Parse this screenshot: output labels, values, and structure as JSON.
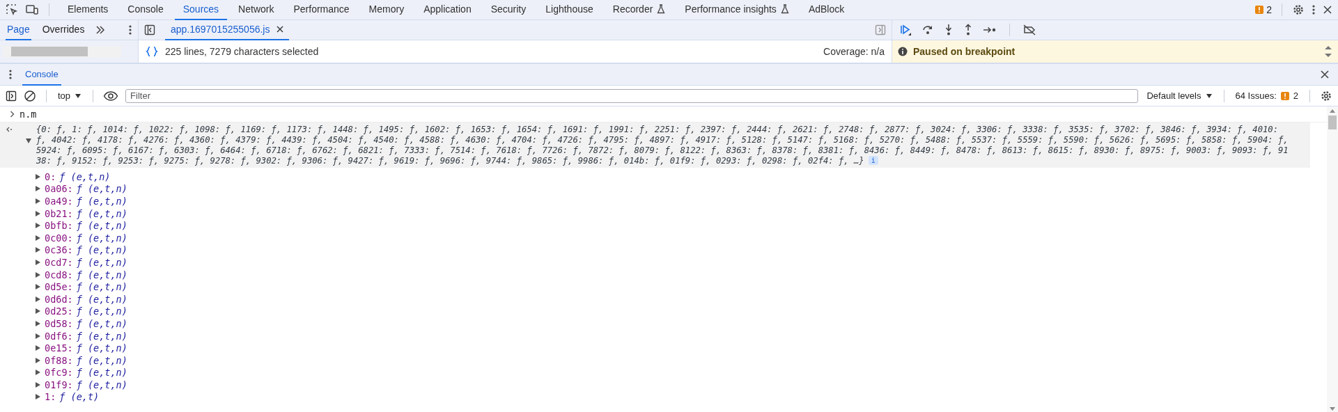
{
  "toolbar_tabs": [
    {
      "label": "Elements",
      "selected": false,
      "experimental": false
    },
    {
      "label": "Console",
      "selected": false,
      "experimental": false
    },
    {
      "label": "Sources",
      "selected": true,
      "experimental": false
    },
    {
      "label": "Network",
      "selected": false,
      "experimental": false
    },
    {
      "label": "Performance",
      "selected": false,
      "experimental": false
    },
    {
      "label": "Memory",
      "selected": false,
      "experimental": false
    },
    {
      "label": "Application",
      "selected": false,
      "experimental": false
    },
    {
      "label": "Security",
      "selected": false,
      "experimental": false
    },
    {
      "label": "Lighthouse",
      "selected": false,
      "experimental": false
    },
    {
      "label": "Recorder",
      "selected": false,
      "experimental": true
    },
    {
      "label": "Performance insights",
      "selected": false,
      "experimental": true
    },
    {
      "label": "AdBlock",
      "selected": false,
      "experimental": false
    }
  ],
  "issues_badge": "2",
  "navigator_tabs": [
    {
      "label": "Page",
      "selected": true
    },
    {
      "label": "Overrides",
      "selected": false
    }
  ],
  "editor_tabs": [
    {
      "label": "app.1697015255056.js",
      "selected": true
    }
  ],
  "status": {
    "selection": "225 lines, 7279 characters selected",
    "coverage": "Coverage: n/a"
  },
  "debugger": {
    "paused_message": "Paused on breakpoint"
  },
  "drawer_tabs": [
    {
      "label": "Console",
      "selected": true
    }
  ],
  "console_toolbar": {
    "context": "top",
    "filter_placeholder": "Filter",
    "levels": "Default levels",
    "issues_label": "64 Issues:",
    "issues_count": "2"
  },
  "console": {
    "input": "n.m",
    "result": {
      "expanded": true,
      "preview_lines": [
        "{0: ƒ, 1: ƒ, 1014: ƒ, 1022: ƒ, 1098: ƒ, 1169: ƒ, 1173: ƒ, 1448: ƒ, 1495: ƒ, 1602: ƒ, 1653: ƒ, 1654: ƒ, 1691: ƒ, 1991: ƒ, 2251: ƒ, 2397: ƒ, 2444: ƒ, 2621: ƒ, 2748: ƒ, 2877: ƒ, 3024: ƒ, 3306: ƒ, 3338: ƒ, 3535: ƒ, 3702: ƒ, 3846: ƒ, 3934: ƒ, 4010:",
        "ƒ, 4042: ƒ, 4178: ƒ, 4276: ƒ, 4360: ƒ, 4379: ƒ, 4439: ƒ, 4504: ƒ, 4540: ƒ, 4588: ƒ, 4630: ƒ, 4704: ƒ, 4726: ƒ, 4795: ƒ, 4897: ƒ, 4917: ƒ, 5128: ƒ, 5147: ƒ, 5168: ƒ, 5270: ƒ, 5488: ƒ, 5537: ƒ, 5559: ƒ, 5590: ƒ, 5626: ƒ, 5695: ƒ, 5858: ƒ, 5904: ƒ,",
        "5924: ƒ, 6095: ƒ, 6167: ƒ, 6303: ƒ, 6464: ƒ, 6718: ƒ, 6762: ƒ, 6821: ƒ, 7333: ƒ, 7514: ƒ, 7618: ƒ, 7726: ƒ, 7872: ƒ, 8079: ƒ, 8122: ƒ, 8363: ƒ, 8378: ƒ, 8381: ƒ, 8436: ƒ, 8449: ƒ, 8478: ƒ, 8613: ƒ, 8615: ƒ, 8930: ƒ, 8975: ƒ, 9003: ƒ, 9093: ƒ, 91",
        "38: ƒ, 9152: ƒ, 9253: ƒ, 9275: ƒ, 9278: ƒ, 9302: ƒ, 9306: ƒ, 9427: ƒ, 9619: ƒ, 9696: ƒ, 9744: ƒ, 9865: ƒ, 9986: ƒ, 014b: ƒ, 01f9: ƒ, 0293: ƒ, 0298: ƒ, 02f4: ƒ, …}"
      ],
      "info_badge": "i",
      "children": [
        {
          "key": "0:",
          "value": "ƒ (e,t,n)",
          "expanded": false
        },
        {
          "key": "0a06:",
          "value": "ƒ (e,t,n)",
          "expanded": false
        },
        {
          "key": "0a49:",
          "value": "ƒ (e,t,n)",
          "expanded": false
        },
        {
          "key": "0b21:",
          "value": "ƒ (e,t,n)",
          "expanded": false
        },
        {
          "key": "0bfb:",
          "value": "ƒ (e,t,n)",
          "expanded": false
        },
        {
          "key": "0c00:",
          "value": "ƒ (e,t,n)",
          "expanded": false
        },
        {
          "key": "0c36:",
          "value": "ƒ (e,t,n)",
          "expanded": false
        },
        {
          "key": "0cd7:",
          "value": "ƒ (e,t,n)",
          "expanded": false
        },
        {
          "key": "0cd8:",
          "value": "ƒ (e,t,n)",
          "expanded": false
        },
        {
          "key": "0d5e:",
          "value": "ƒ (e,t,n)",
          "expanded": false
        },
        {
          "key": "0d6d:",
          "value": "ƒ (e,t,n)",
          "expanded": false
        },
        {
          "key": "0d25:",
          "value": "ƒ (e,t,n)",
          "expanded": false
        },
        {
          "key": "0d58:",
          "value": "ƒ (e,t,n)",
          "expanded": false
        },
        {
          "key": "0df6:",
          "value": "ƒ (e,t,n)",
          "expanded": false
        },
        {
          "key": "0e15:",
          "value": "ƒ (e,t,n)",
          "expanded": false
        },
        {
          "key": "0f88:",
          "value": "ƒ (e,t,n)",
          "expanded": false
        },
        {
          "key": "0fc9:",
          "value": "ƒ (e,t,n)",
          "expanded": false
        },
        {
          "key": "01f9:",
          "value": "ƒ (e,t,n)",
          "expanded": false
        },
        {
          "key": "1:",
          "value": "ƒ (e,t)",
          "expanded": false
        }
      ]
    }
  }
}
